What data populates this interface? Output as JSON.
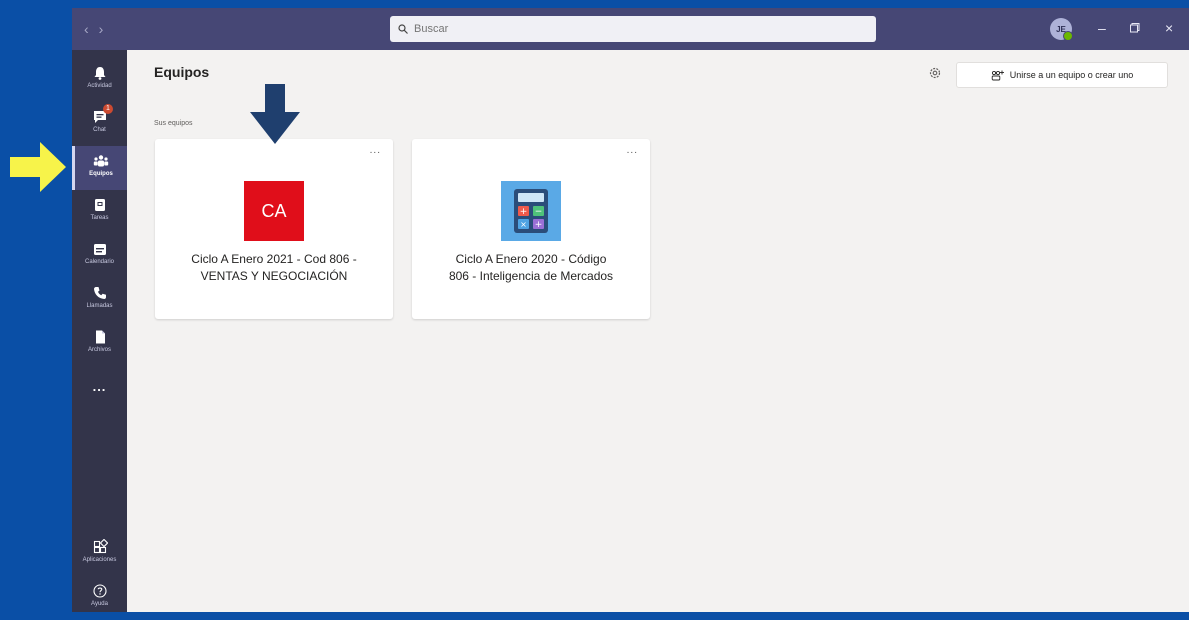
{
  "titlebar": {
    "search_placeholder": "Buscar",
    "avatar_initials": "JE"
  },
  "rail": {
    "items": [
      {
        "label": "Actividad",
        "icon": "bell-icon"
      },
      {
        "label": "Chat",
        "icon": "chat-icon",
        "badge": "1"
      },
      {
        "label": "Equipos",
        "icon": "teams-icon",
        "active": true
      },
      {
        "label": "Tareas",
        "icon": "assignments-icon"
      },
      {
        "label": "Calendario",
        "icon": "calendar-icon"
      },
      {
        "label": "Llamadas",
        "icon": "phone-icon"
      },
      {
        "label": "Archivos",
        "icon": "files-icon"
      }
    ],
    "more": "...",
    "bottom": [
      {
        "label": "Aplicaciones",
        "icon": "apps-icon"
      },
      {
        "label": "Ayuda",
        "icon": "help-icon"
      }
    ]
  },
  "main": {
    "title": "Equipos",
    "join_button": "Unirse a un equipo o crear uno",
    "section_label": "Sus equipos",
    "teams": [
      {
        "logo_text": "CA",
        "logo_color": "#e00e1a",
        "name_line1": "Ciclo A Enero 2021 - Cod 806 -",
        "name_line2": "VENTAS Y NEGOCIACIÓN",
        "more": "..."
      },
      {
        "logo_icon": "calculator-icon",
        "logo_color": "#5aa9e6",
        "name_line1": "Ciclo A Enero 2020 - Código",
        "name_line2": "806 - Inteligencia de Mercados",
        "more": "..."
      }
    ]
  },
  "colors": {
    "background": "#0a4fa6",
    "titlebar": "#464775",
    "rail": "#33344a",
    "annotation_arrow_down": "#1f3f6e",
    "annotation_arrow_right": "#f7f34a"
  }
}
